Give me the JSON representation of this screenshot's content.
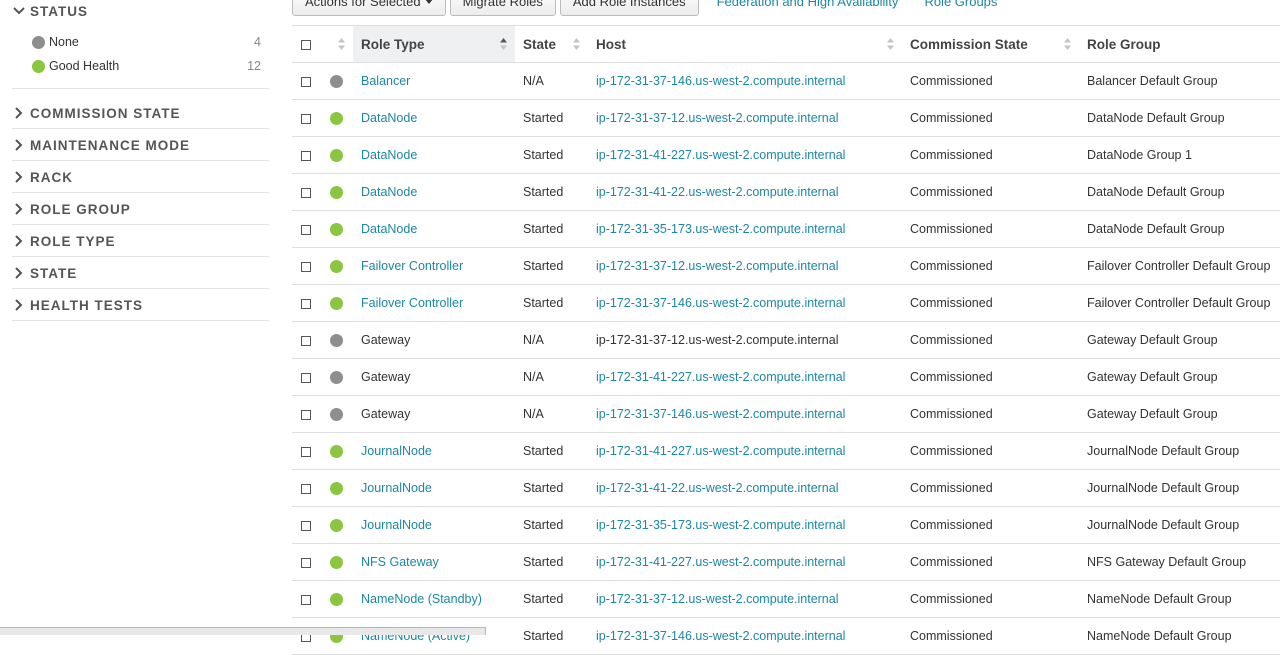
{
  "colors": {
    "none": "#8e8e8e",
    "good": "#8ac63f",
    "link": "#1c87a3"
  },
  "sidebar": {
    "status": {
      "title": "STATUS",
      "items": [
        {
          "label": "None",
          "count": "4",
          "color": "#8e8e8e"
        },
        {
          "label": "Good Health",
          "count": "12",
          "color": "#8ac63f"
        }
      ]
    },
    "facets": [
      "COMMISSION STATE",
      "MAINTENANCE MODE",
      "RACK",
      "ROLE GROUP",
      "ROLE TYPE",
      "STATE",
      "HEALTH TESTS"
    ]
  },
  "toolbar": {
    "actions_label": "Actions for Selected",
    "migrate_label": "Migrate Roles",
    "add_label": "Add Role Instances",
    "federation_label": "Federation and High Availability",
    "role_groups_label": "Role Groups"
  },
  "table": {
    "headers": {
      "role_type": "Role Type",
      "state": "State",
      "host": "Host",
      "commission": "Commission State",
      "role_group": "Role Group"
    },
    "rows": [
      {
        "health": "none",
        "role": "Balancer",
        "role_link": true,
        "state": "N/A",
        "host": "ip-172-31-37-146.us-west-2.compute.internal",
        "host_link": true,
        "commission": "Commissioned",
        "group": "Balancer Default Group"
      },
      {
        "health": "good",
        "role": "DataNode",
        "role_link": true,
        "state": "Started",
        "host": "ip-172-31-37-12.us-west-2.compute.internal",
        "host_link": true,
        "commission": "Commissioned",
        "group": "DataNode Default Group"
      },
      {
        "health": "good",
        "role": "DataNode",
        "role_link": true,
        "state": "Started",
        "host": "ip-172-31-41-227.us-west-2.compute.internal",
        "host_link": true,
        "commission": "Commissioned",
        "group": "DataNode Group 1"
      },
      {
        "health": "good",
        "role": "DataNode",
        "role_link": true,
        "state": "Started",
        "host": "ip-172-31-41-22.us-west-2.compute.internal",
        "host_link": true,
        "commission": "Commissioned",
        "group": "DataNode Default Group"
      },
      {
        "health": "good",
        "role": "DataNode",
        "role_link": true,
        "state": "Started",
        "host": "ip-172-31-35-173.us-west-2.compute.internal",
        "host_link": true,
        "commission": "Commissioned",
        "group": "DataNode Default Group"
      },
      {
        "health": "good",
        "role": "Failover Controller",
        "role_link": true,
        "state": "Started",
        "host": "ip-172-31-37-12.us-west-2.compute.internal",
        "host_link": true,
        "commission": "Commissioned",
        "group": "Failover Controller Default Group"
      },
      {
        "health": "good",
        "role": "Failover Controller",
        "role_link": true,
        "state": "Started",
        "host": "ip-172-31-37-146.us-west-2.compute.internal",
        "host_link": true,
        "commission": "Commissioned",
        "group": "Failover Controller Default Group"
      },
      {
        "health": "none",
        "role": "Gateway",
        "role_link": false,
        "state": "N/A",
        "host": "ip-172-31-37-12.us-west-2.compute.internal",
        "host_link": false,
        "commission": "Commissioned",
        "group": "Gateway Default Group"
      },
      {
        "health": "none",
        "role": "Gateway",
        "role_link": false,
        "state": "N/A",
        "host": "ip-172-31-41-227.us-west-2.compute.internal",
        "host_link": true,
        "commission": "Commissioned",
        "group": "Gateway Default Group"
      },
      {
        "health": "none",
        "role": "Gateway",
        "role_link": false,
        "state": "N/A",
        "host": "ip-172-31-37-146.us-west-2.compute.internal",
        "host_link": true,
        "commission": "Commissioned",
        "group": "Gateway Default Group"
      },
      {
        "health": "good",
        "role": "JournalNode",
        "role_link": true,
        "state": "Started",
        "host": "ip-172-31-41-227.us-west-2.compute.internal",
        "host_link": true,
        "commission": "Commissioned",
        "group": "JournalNode Default Group"
      },
      {
        "health": "good",
        "role": "JournalNode",
        "role_link": true,
        "state": "Started",
        "host": "ip-172-31-41-22.us-west-2.compute.internal",
        "host_link": true,
        "commission": "Commissioned",
        "group": "JournalNode Default Group"
      },
      {
        "health": "good",
        "role": "JournalNode",
        "role_link": true,
        "state": "Started",
        "host": "ip-172-31-35-173.us-west-2.compute.internal",
        "host_link": true,
        "commission": "Commissioned",
        "group": "JournalNode Default Group"
      },
      {
        "health": "good",
        "role": "NFS Gateway",
        "role_link": true,
        "state": "Started",
        "host": "ip-172-31-41-227.us-west-2.compute.internal",
        "host_link": true,
        "commission": "Commissioned",
        "group": "NFS Gateway Default Group"
      },
      {
        "health": "good",
        "role": "NameNode (Standby)",
        "role_link": true,
        "state": "Started",
        "host": "ip-172-31-37-12.us-west-2.compute.internal",
        "host_link": true,
        "commission": "Commissioned",
        "group": "NameNode Default Group"
      },
      {
        "health": "good",
        "role": "NameNode (Active)",
        "role_link": true,
        "state": "Started",
        "host": "ip-172-31-37-146.us-west-2.compute.internal",
        "host_link": true,
        "commission": "Commissioned",
        "group": "NameNode Default Group"
      }
    ]
  }
}
